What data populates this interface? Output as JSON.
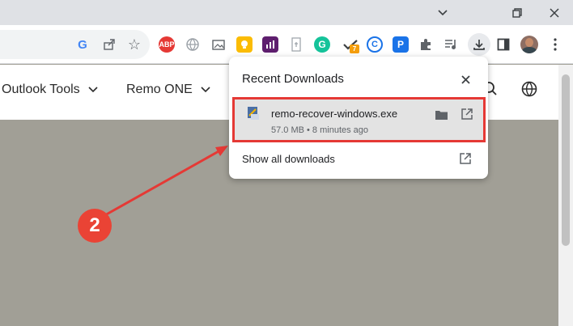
{
  "window": {
    "dropdown_icon": "chevron-down-icon",
    "restore_icon": "restore-icon",
    "close_icon": "close-icon"
  },
  "toolbar": {
    "icons": [
      "google-icon",
      "share-icon",
      "star-icon",
      "abp-icon",
      "globe-extension-icon",
      "screenshot-icon",
      "bulb-icon",
      "chart-icon",
      "notes-icon",
      "grammarly-icon",
      "checkmark-icon",
      "c-icon",
      "p-icon",
      "extensions-icon",
      "media-icon",
      "download-icon",
      "sidebar-icon",
      "avatar",
      "more-icon"
    ],
    "abp_label": "ABP",
    "extension_badge_count": "7"
  },
  "site_nav": {
    "items": [
      {
        "label": "Outlook Tools"
      },
      {
        "label": "Remo ONE"
      }
    ]
  },
  "downloads_popup": {
    "title": "Recent Downloads",
    "item": {
      "filename": "remo-recover-windows.exe",
      "meta": "57.0 MB • 8 minutes ago"
    },
    "show_all": "Show all downloads"
  },
  "annotation": {
    "step_number": "2"
  },
  "colors": {
    "highlight_border": "#e53935",
    "badge": "#ea4335",
    "page_bg": "#a19f95"
  }
}
